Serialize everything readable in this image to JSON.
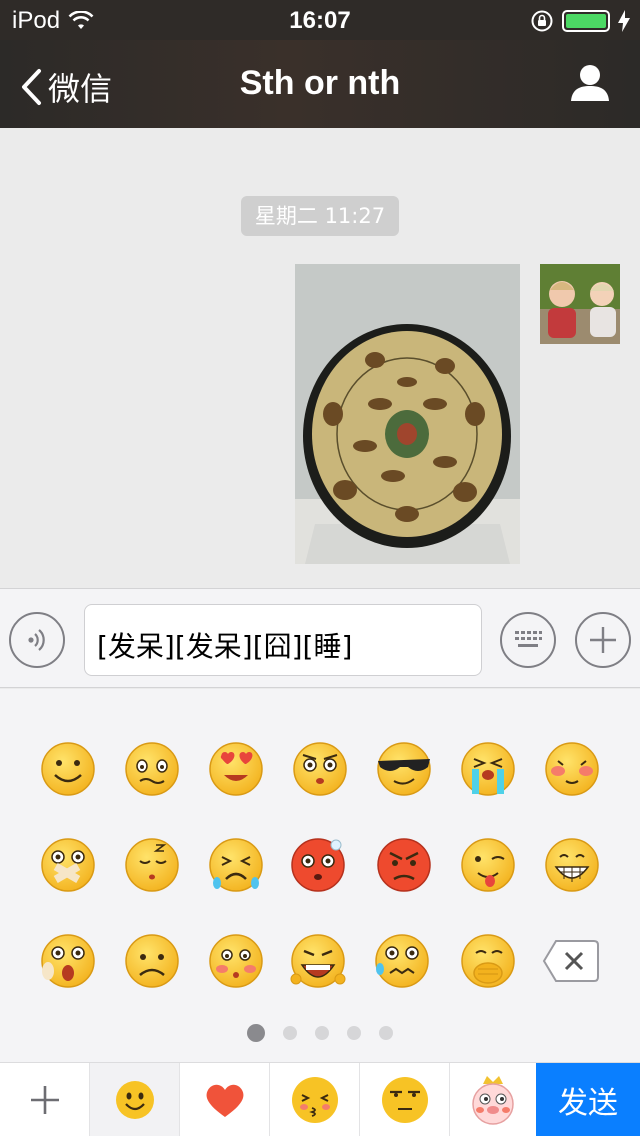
{
  "status_bar": {
    "carrier": "iPod",
    "time": "16:07",
    "battery_level": 1.0,
    "battery_color": "#4cd964"
  },
  "nav": {
    "back_label": "微信",
    "title": "Sth or nth",
    "profile_icon": "person-icon"
  },
  "chat": {
    "timestamp": "星期二 11:27",
    "messages": [
      {
        "type": "image",
        "sender": "self",
        "content": "photo of a ceramic plate"
      }
    ]
  },
  "input": {
    "value": "[发呆][发呆][囧][睡]",
    "voice_icon": "voice-icon",
    "keyboard_icon": "keyboard-icon",
    "more_icon": "plus-icon"
  },
  "emoji_panel": {
    "rows": [
      [
        "smile",
        "embarrassed",
        "heart-eyes",
        "daze",
        "cool",
        "sob",
        "shy"
      ],
      [
        "shut-mouth",
        "sleepy",
        "cry",
        "awkward",
        "angry",
        "tongue",
        "grin"
      ],
      [
        "surprised",
        "sad",
        "blush",
        "scream",
        "sweat",
        "snicker",
        "delete"
      ]
    ],
    "page_count": 5,
    "current_page": 1
  },
  "tab_bar": {
    "tabs": [
      "plus",
      "emoji",
      "heart",
      "kiss-face",
      "smirk-face",
      "pig-face"
    ],
    "selected": "emoji",
    "send_label": "发送",
    "accent": "#0a7fff"
  }
}
